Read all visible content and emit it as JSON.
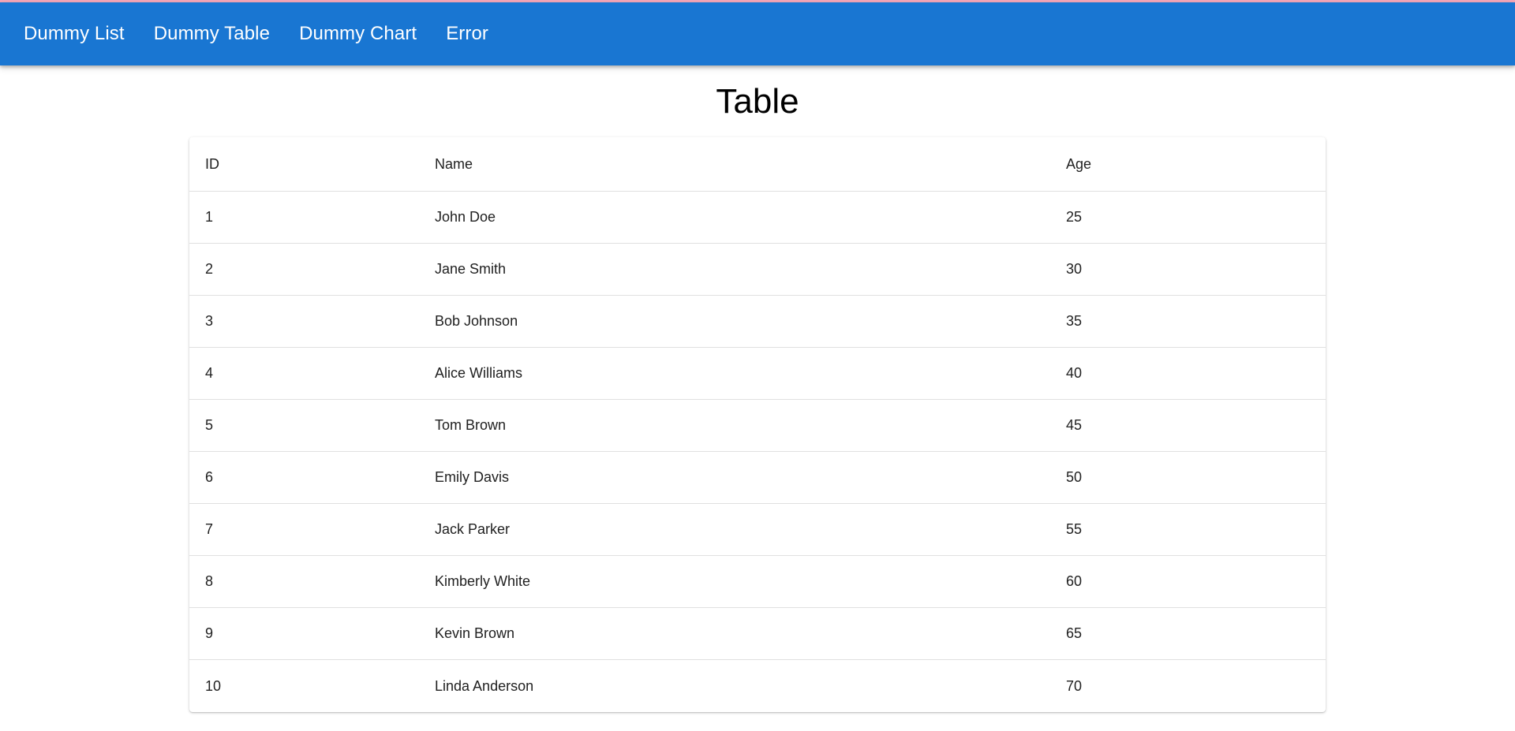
{
  "nav": {
    "items": [
      {
        "label": "Dummy List"
      },
      {
        "label": "Dummy Table"
      },
      {
        "label": "Dummy Chart"
      },
      {
        "label": "Error"
      }
    ]
  },
  "page": {
    "title": "Table"
  },
  "table": {
    "headers": {
      "id": "ID",
      "name": "Name",
      "age": "Age"
    },
    "rows": [
      {
        "id": "1",
        "name": "John Doe",
        "age": "25"
      },
      {
        "id": "2",
        "name": "Jane Smith",
        "age": "30"
      },
      {
        "id": "3",
        "name": "Bob Johnson",
        "age": "35"
      },
      {
        "id": "4",
        "name": "Alice Williams",
        "age": "40"
      },
      {
        "id": "5",
        "name": "Tom Brown",
        "age": "45"
      },
      {
        "id": "6",
        "name": "Emily Davis",
        "age": "50"
      },
      {
        "id": "7",
        "name": "Jack Parker",
        "age": "55"
      },
      {
        "id": "8",
        "name": "Kimberly White",
        "age": "60"
      },
      {
        "id": "9",
        "name": "Kevin Brown",
        "age": "65"
      },
      {
        "id": "10",
        "name": "Linda Anderson",
        "age": "70"
      }
    ]
  },
  "colors": {
    "navbar": "#1976d2",
    "top_accent": "#f4a7b9",
    "text": "#212121"
  }
}
